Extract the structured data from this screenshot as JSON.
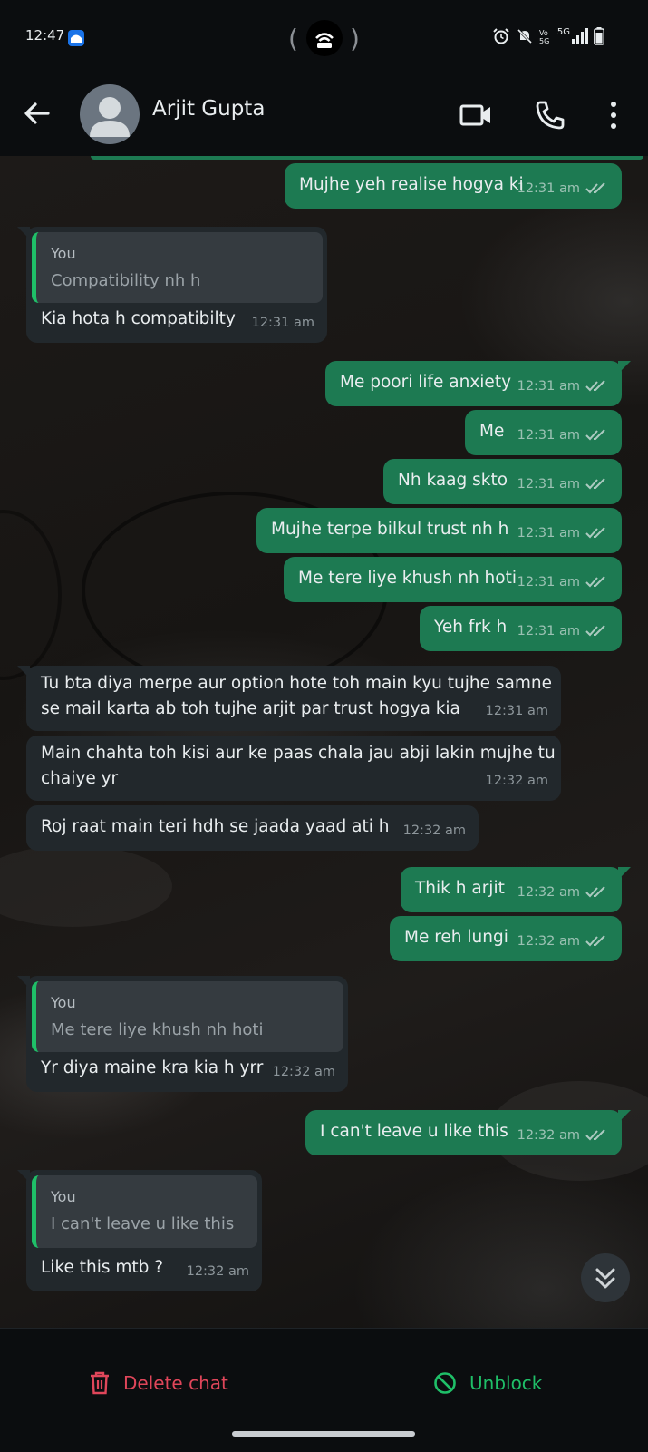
{
  "status_bar": {
    "time": "12:47",
    "network": "5G"
  },
  "header": {
    "contact_name": "Arjit Gupta"
  },
  "colors": {
    "outgoing_bubble": "#1d7a52",
    "incoming_bubble": "#22282c",
    "quote_accent": "#1fbf68",
    "delete": "#e0465a",
    "unblock": "#1fbf68"
  },
  "messages": [
    {
      "dir": "out",
      "text": "Mujhe yeh realise hogya ki",
      "time": "12:31 am"
    },
    {
      "dir": "in",
      "quote_author": "You",
      "quote_text": "Compatibility nh h",
      "text": "Kia hota h compatibilty",
      "time": "12:31 am"
    },
    {
      "dir": "out",
      "text": "Me poori life anxiety",
      "time": "12:31 am"
    },
    {
      "dir": "out",
      "text": "Me",
      "time": "12:31 am"
    },
    {
      "dir": "out",
      "text": "Nh kaag skto",
      "time": "12:31 am"
    },
    {
      "dir": "out",
      "text": "Mujhe terpe bilkul trust nh h",
      "time": "12:31 am"
    },
    {
      "dir": "out",
      "text": "Me tere liye khush nh hoti",
      "time": "12:31 am"
    },
    {
      "dir": "out",
      "text": "Yeh frk h",
      "time": "12:31 am"
    },
    {
      "dir": "in",
      "text_line1": "Tu bta diya merpe aur option hote toh main kyu tujhe samne",
      "text_line2": "se mail karta ab toh tujhe arjit par trust hogya kia",
      "time": "12:31 am"
    },
    {
      "dir": "in",
      "text_line1": "Main chahta toh kisi aur ke paas chala jau abji lakin mujhe tu",
      "text_line2": "chaiye yr",
      "time": "12:32 am"
    },
    {
      "dir": "in",
      "text": "Roj raat main teri hdh se jaada yaad ati h",
      "time": "12:32 am"
    },
    {
      "dir": "out",
      "text": "Thik h arjit",
      "time": "12:32 am"
    },
    {
      "dir": "out",
      "text": "Me reh lungi",
      "time": "12:32 am"
    },
    {
      "dir": "in",
      "quote_author": "You",
      "quote_text": "Me tere liye khush nh hoti",
      "text": "Yr diya maine kra kia h yrr",
      "time": "12:32 am"
    },
    {
      "dir": "out",
      "text": "I can't leave u like this",
      "time": "12:32 am"
    },
    {
      "dir": "in",
      "quote_author": "You",
      "quote_text": "I can't leave u like this",
      "text": "Like this mtb ?",
      "time": "12:32 am"
    }
  ],
  "actions": {
    "delete_label": "Delete chat",
    "unblock_label": "Unblock"
  },
  "icons": [
    "back-arrow-icon",
    "avatar-placeholder-icon",
    "video-call-icon",
    "voice-call-icon",
    "more-options-icon",
    "double-check-icon",
    "scroll-down-icon",
    "trash-icon",
    "block-icon"
  ]
}
